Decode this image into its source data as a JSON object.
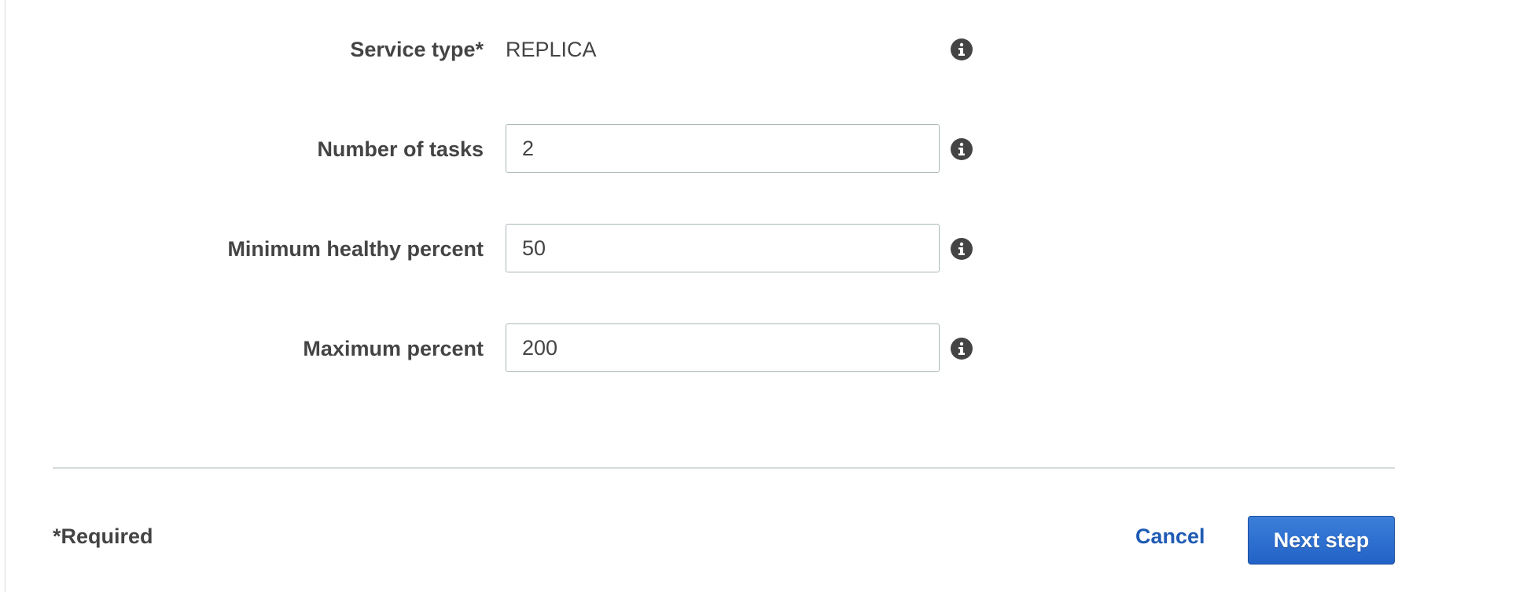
{
  "form": {
    "fields": [
      {
        "label": "Service type*",
        "value": "REPLICA",
        "kind": "static",
        "info_icon": "info-icon"
      },
      {
        "label": "Number of tasks",
        "value": "2",
        "kind": "input",
        "info_icon": "info-icon"
      },
      {
        "label": "Minimum healthy percent",
        "value": "50",
        "kind": "input",
        "info_icon": "info-icon"
      },
      {
        "label": "Maximum percent",
        "value": "200",
        "kind": "input",
        "info_icon": "info-icon"
      }
    ]
  },
  "footer": {
    "required_note": "*Required",
    "cancel_label": "Cancel",
    "next_label": "Next step"
  },
  "colors": {
    "text": "#444444",
    "link": "#1f5bb4",
    "primary_button": "#2a6ccc",
    "input_border": "#aab7b8",
    "divider": "#d5dbdb"
  }
}
